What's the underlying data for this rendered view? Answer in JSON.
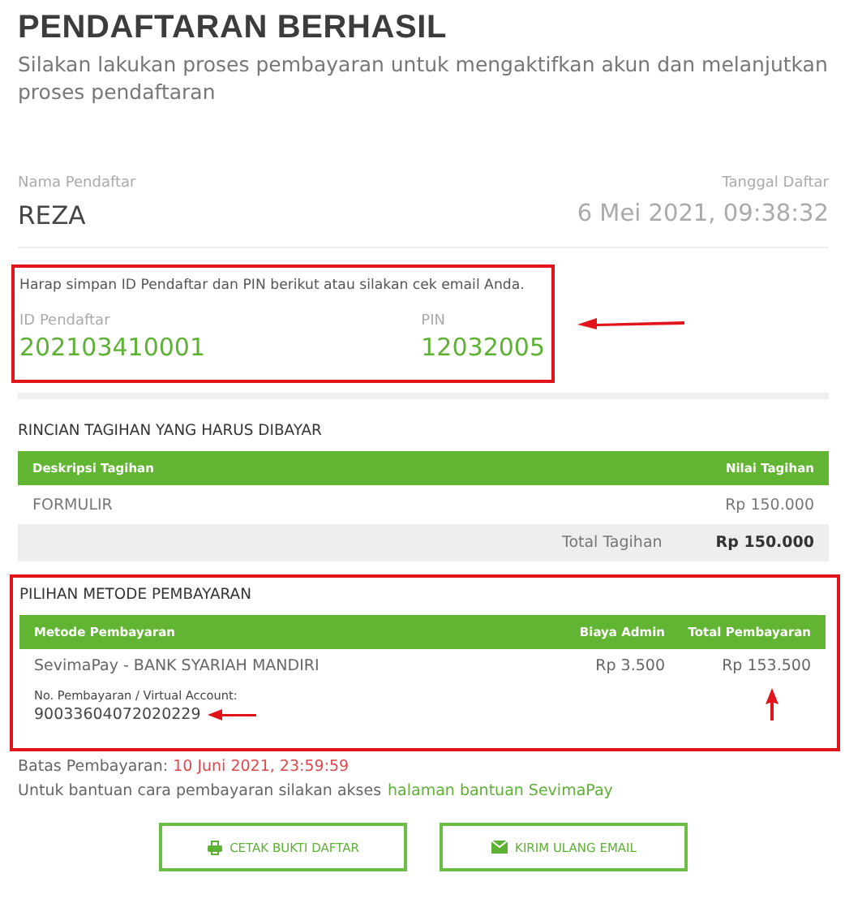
{
  "header": {
    "title": "PENDAFTARAN BERHASIL",
    "subtitle": "Silakan lakukan proses pembayaran untuk mengaktifkan akun dan melanjutkan proses pendaftaran"
  },
  "registrant": {
    "name_label": "Nama Pendaftar",
    "name": "REZA",
    "date_label": "Tanggal Daftar",
    "date": "6 Mei 2021, 09:38:32"
  },
  "credentials": {
    "notice": "Harap simpan ID Pendaftar dan PIN berikut atau silakan cek email Anda.",
    "id_label": "ID Pendaftar",
    "id": "202103410001",
    "pin_label": "PIN",
    "pin": "12032005"
  },
  "bill": {
    "title": "RINCIAN TAGIHAN YANG HARUS DIBAYAR",
    "columns": [
      "Deskripsi Tagihan",
      "Nilai Tagihan"
    ],
    "rows": [
      {
        "description": "FORMULIR",
        "amount": "Rp 150.000"
      }
    ],
    "total_label": "Total Tagihan",
    "total": "Rp 150.000"
  },
  "payment": {
    "title": "PILIHAN METODE PEMBAYARAN",
    "columns": [
      "Metode Pembayaran",
      "Biaya Admin",
      "Total Pembayaran"
    ],
    "rows": [
      {
        "method": "SevimaPay - BANK SYARIAH MANDIRI",
        "va_label": "No. Pembayaran / Virtual Account:",
        "va": "90033604072020229",
        "admin": "Rp 3.500",
        "total": "Rp 153.500"
      }
    ]
  },
  "deadline": {
    "label": "Batas Pembayaran:",
    "value": "10 Juni 2021, 23:59:59"
  },
  "help": {
    "text": "Untuk bantuan cara pembayaran silakan akses",
    "link": "halaman bantuan SevimaPay"
  },
  "buttons": [
    {
      "kind": "print",
      "label": "CETAK BUKTI DAFTAR"
    },
    {
      "kind": "email",
      "label": "KIRIM ULANG EMAIL"
    }
  ]
}
